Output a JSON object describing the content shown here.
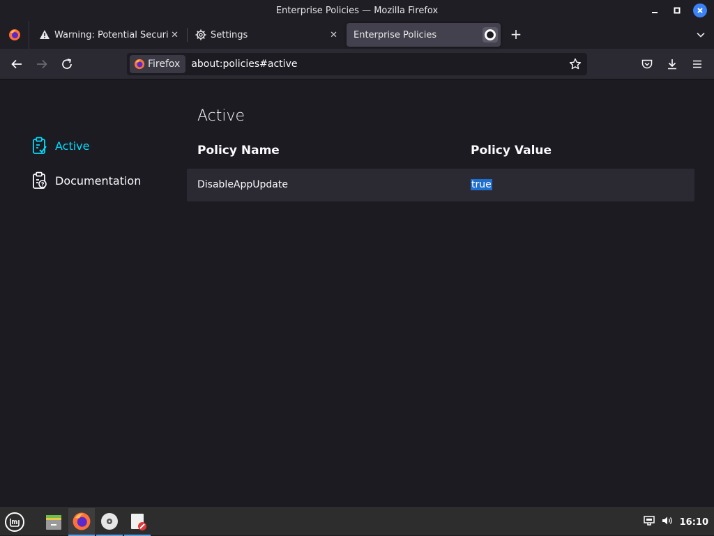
{
  "window": {
    "title": "Enterprise Policies — Mozilla Firefox"
  },
  "tabs": [
    {
      "label": "Warning: Potential Security Risk Ahead",
      "icon": "warning-icon"
    },
    {
      "label": "Settings",
      "icon": "gear-icon"
    },
    {
      "label": "Enterprise Policies",
      "icon": "none",
      "active": true
    }
  ],
  "navbar": {
    "identity_label": "Firefox",
    "url": "about:policies#active"
  },
  "sidebar": {
    "items": [
      {
        "label": "Active",
        "icon": "clipboard-check-icon",
        "selected": true
      },
      {
        "label": "Documentation",
        "icon": "clipboard-question-icon",
        "selected": false
      }
    ]
  },
  "main": {
    "title": "Active",
    "columns": [
      "Policy Name",
      "Policy Value"
    ],
    "rows": [
      {
        "name": "DisableAppUpdate",
        "value": "true"
      }
    ]
  },
  "taskbar": {
    "clock": "16:10",
    "apps": [
      "mint-menu-icon",
      "files-icon",
      "firefox-icon",
      "disc-icon",
      "text-editor-icon"
    ]
  },
  "colors": {
    "accent": "#00ddff",
    "selection": "#1f6fd1",
    "background": "#1c1b22"
  }
}
